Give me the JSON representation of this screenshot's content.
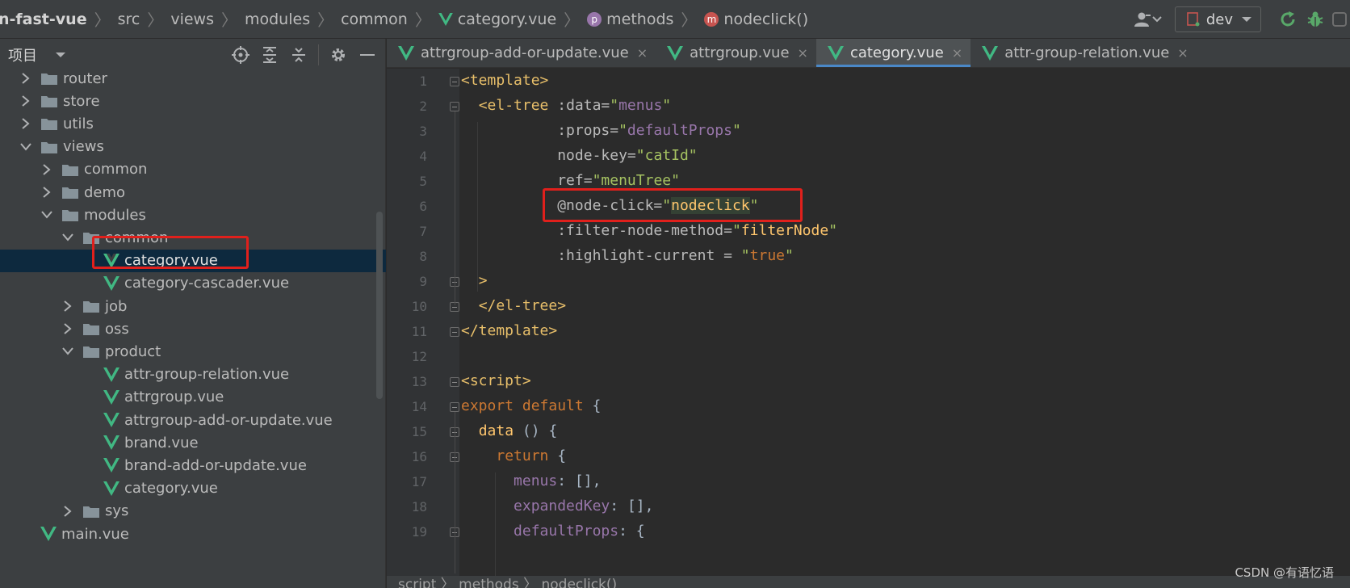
{
  "breadcrumb": {
    "items": [
      "n-fast-vue",
      "src",
      "views",
      "modules",
      "common",
      "category.vue",
      "methods",
      "nodeclick()"
    ],
    "method_badge_p": "p",
    "method_badge_m": "m"
  },
  "toolbar": {
    "run_config": "dev"
  },
  "project_panel": {
    "title": "项目"
  },
  "tree": [
    {
      "label": "router",
      "kind": "folder",
      "expanded": false
    },
    {
      "label": "store",
      "kind": "folder",
      "expanded": false
    },
    {
      "label": "utils",
      "kind": "folder",
      "expanded": false
    },
    {
      "label": "views",
      "kind": "folder",
      "expanded": true
    },
    {
      "label": "common",
      "kind": "folder",
      "expanded": false
    },
    {
      "label": "demo",
      "kind": "folder",
      "expanded": false
    },
    {
      "label": "modules",
      "kind": "folder",
      "expanded": true
    },
    {
      "label": "common",
      "kind": "folder",
      "expanded": true
    },
    {
      "label": "category.vue",
      "kind": "vue",
      "selected": true
    },
    {
      "label": "category-cascader.vue",
      "kind": "vue"
    },
    {
      "label": "job",
      "kind": "folder",
      "expanded": false
    },
    {
      "label": "oss",
      "kind": "folder",
      "expanded": false
    },
    {
      "label": "product",
      "kind": "folder",
      "expanded": true
    },
    {
      "label": "attr-group-relation.vue",
      "kind": "vue"
    },
    {
      "label": "attrgroup.vue",
      "kind": "vue"
    },
    {
      "label": "attrgroup-add-or-update.vue",
      "kind": "vue"
    },
    {
      "label": "brand.vue",
      "kind": "vue"
    },
    {
      "label": "brand-add-or-update.vue",
      "kind": "vue"
    },
    {
      "label": "category.vue",
      "kind": "vue"
    },
    {
      "label": "sys",
      "kind": "folder",
      "expanded": false
    },
    {
      "label": "main.vue",
      "kind": "vue"
    }
  ],
  "tabs": [
    {
      "label": "attrgroup-add-or-update.vue",
      "active": false
    },
    {
      "label": "attrgroup.vue",
      "active": false
    },
    {
      "label": "category.vue",
      "active": true
    },
    {
      "label": "attr-group-relation.vue",
      "active": false
    }
  ],
  "tab_close_glyph": "×",
  "line_numbers": [
    "1",
    "2",
    "3",
    "4",
    "5",
    "6",
    "7",
    "8",
    "9",
    "10",
    "11",
    "12",
    "13",
    "14",
    "15",
    "16",
    "17",
    "18",
    "19"
  ],
  "code": {
    "l1_open": "<template>",
    "l2_tag": "<el-tree",
    "l2_attr": " :data=",
    "l2_val": "menus",
    "l3_attr": ":props=",
    "l3_val": "defaultProps",
    "l4_attr": "node-key=",
    "l4_val": "catId",
    "l5_attr": "ref=",
    "l5_val": "menuTree",
    "l6_attr": "@node-click=",
    "l6_val": "nodeclick",
    "l7_attr": ":filter-node-method=",
    "l7_val": "filterNode",
    "l8_attr": ":highlight-current = ",
    "l8_val": "true",
    "l9": ">",
    "l10": "</el-tree>",
    "l11": "</template>",
    "l13": "<script>",
    "l14_kw": "export default",
    "l14_rest": " {",
    "l15_fn": "data",
    "l15_rest": " () {",
    "l16_kw": "return",
    "l16_rest": " {",
    "l17_prop": "menus",
    "l17_rest": ": [],",
    "l18_prop": "expandedKey",
    "l18_rest": ": [],",
    "l19_prop": "defaultProps",
    "l19_rest": ": {"
  },
  "status_crumbs": "script  〉 methods  〉 nodeclick()",
  "watermark": "CSDN @有语忆语",
  "colors": {
    "accent": "#4a88c7",
    "highlight_box": "#e0201c",
    "vue_green": "#41b883"
  }
}
